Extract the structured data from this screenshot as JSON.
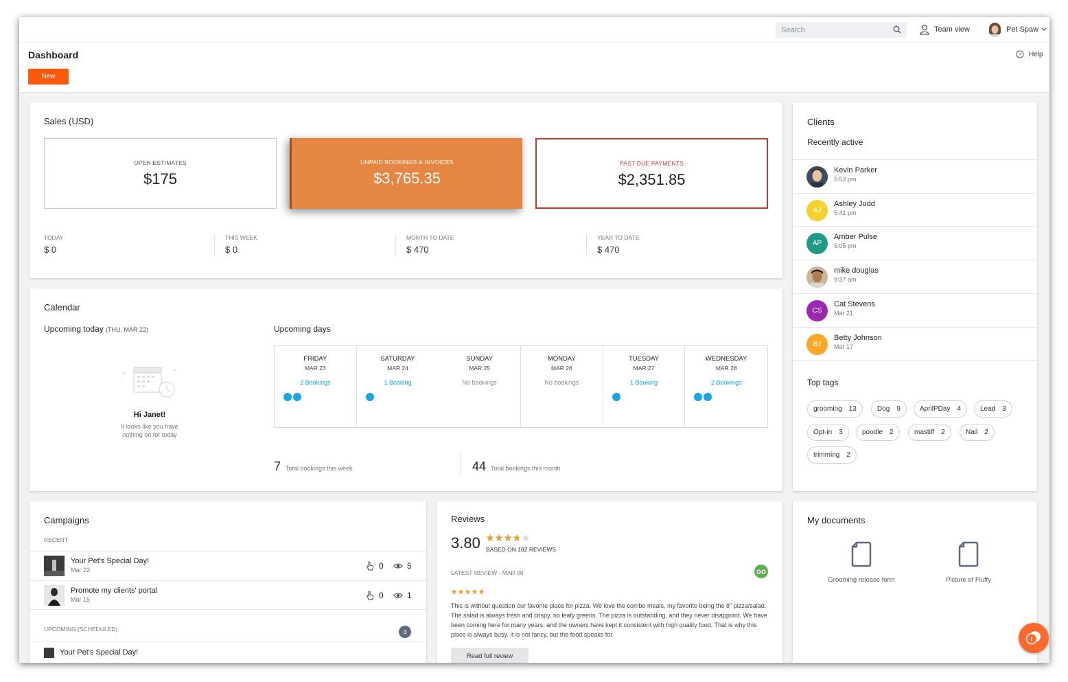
{
  "header": {
    "search_placeholder": "Search",
    "team_view": "Team view",
    "user_name": "Pet Spaw",
    "page_title": "Dashboard",
    "help": "Help",
    "new_button": "New"
  },
  "sales": {
    "title": "Sales",
    "currency": "(USD)",
    "open_estimates": {
      "label": "OPEN ESTIMATES",
      "value": "$175"
    },
    "unpaid": {
      "label": "UNPAID BOOKINGS & INVOICES",
      "value": "$3,765.35"
    },
    "past_due": {
      "label": "PAST DUE PAYMENTS",
      "value": "$2,351.85"
    },
    "periods": [
      {
        "label": "TODAY",
        "value": "$ 0"
      },
      {
        "label": "THIS WEEK",
        "value": "$ 0"
      },
      {
        "label": "MONTH TO DATE",
        "value": "$ 470"
      },
      {
        "label": "YEAR TO DATE",
        "value": "$ 470"
      }
    ]
  },
  "calendar": {
    "title": "Calendar",
    "upcoming_today": "Upcoming today",
    "today_date": "(THU, MAR 22)",
    "greeting": "Hi Janet!",
    "empty_line1": "It looks like you have",
    "empty_line2": "nothing on for today",
    "upcoming_days": "Upcoming days",
    "days": [
      {
        "name": "FRIDAY",
        "date": "MAR 23",
        "bookings": "2 Bookings",
        "dots": 2
      },
      {
        "name": "SATURDAY",
        "date": "MAR 24",
        "bookings": "1 Booking",
        "dots": 1
      },
      {
        "name": "SUNDAY",
        "date": "MAR 25",
        "bookings": "No bookings",
        "dots": 0
      },
      {
        "name": "MONDAY",
        "date": "MAR 26",
        "bookings": "No bookings",
        "dots": 0
      },
      {
        "name": "TUESDAY",
        "date": "MAR 27",
        "bookings": "1 Booking",
        "dots": 1
      },
      {
        "name": "WEDNESDAY",
        "date": "MAR 28",
        "bookings": "2 Bookings",
        "dots": 2
      }
    ],
    "week_total": "7",
    "week_label": "Total bookings this week",
    "month_total": "44",
    "month_label": "Total bookings this month"
  },
  "clients": {
    "title": "Clients",
    "subtitle": "Recently active",
    "items": [
      {
        "name": "Kevin Parker",
        "time": "5:52 pm",
        "initials": "",
        "color": "#3a4a5c"
      },
      {
        "name": "Ashley Judd",
        "time": "5:41 pm",
        "initials": "AJ",
        "color": "#f5d130"
      },
      {
        "name": "Amber Pulse",
        "time": "5:05 pm",
        "initials": "AP",
        "color": "#1f9a86"
      },
      {
        "name": "mike douglas",
        "time": "9:37 am",
        "initials": "",
        "color": "#8a6a4a"
      },
      {
        "name": "Cat Stevens",
        "time": "Mar 21",
        "initials": "CS",
        "color": "#9c27b0"
      },
      {
        "name": "Betty Johnson",
        "time": "Mar 17",
        "initials": "BJ",
        "color": "#f9a825"
      }
    ],
    "tags_title": "Top tags",
    "tags": [
      {
        "name": "grooming",
        "count": "13"
      },
      {
        "name": "Dog",
        "count": "9"
      },
      {
        "name": "AprilPDay",
        "count": "4"
      },
      {
        "name": "Lead",
        "count": "3"
      },
      {
        "name": "Opt-in",
        "count": "3"
      },
      {
        "name": "poodle",
        "count": "2"
      },
      {
        "name": "mastiff",
        "count": "2"
      },
      {
        "name": "Nail",
        "count": "2"
      },
      {
        "name": "trimming",
        "count": "2"
      }
    ]
  },
  "campaigns": {
    "title": "Campaigns",
    "recent_label": "RECENT",
    "recent": [
      {
        "title": "Your Pet's Special Day!",
        "date": "Mar 22",
        "clicks": "0",
        "views": "5"
      },
      {
        "title": "Promote my clients' portal",
        "date": "Mar 15",
        "clicks": "0",
        "views": "1"
      }
    ],
    "upcoming_label": "UPCOMING (SCHEDULED)",
    "upcoming_count": "3",
    "upcoming_first": "Your Pet's Special Day!"
  },
  "reviews": {
    "title": "Reviews",
    "score": "3.80",
    "rating": 3.8,
    "based_on": "BASED ON 182 REVIEWS",
    "latest_label": "LATEST REVIEW - MAR 08",
    "latest_stars": 5,
    "text": "This is without question our favorite place for pizza. We love the combo meals, my favorite being the 8\" pizza/salad. The salad is always fresh and crispy, no leafy greens. The pizza is outstanding, and they never disappoint. We have been coming here for many years, and the owners have kept it consistent with high quality food. That is why this place is always busy. It is not fancy, but the food speaks for",
    "read_button": "Read full review",
    "star_color": "#e5a23b"
  },
  "documents": {
    "title": "My documents",
    "items": [
      "Grooming release form",
      "Picture of Fluffy"
    ]
  }
}
